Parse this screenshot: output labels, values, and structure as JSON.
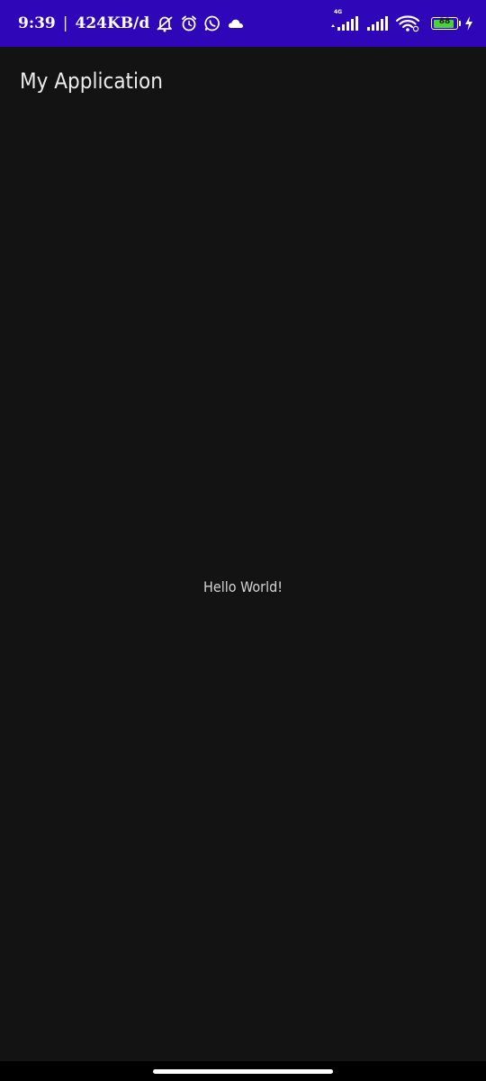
{
  "status_bar": {
    "time": "9:39",
    "separator": "|",
    "net_speed": "424KB/d",
    "network_type": "4G",
    "battery_level": "88",
    "background_color": "#2f06b8",
    "icons_left": [
      "mute-icon",
      "alarm-icon",
      "whatsapp-icon",
      "cloud-icon"
    ],
    "icons_right": [
      "signal-4g-icon",
      "signal-icon",
      "wifi-icon",
      "battery-icon",
      "charging-bolt-icon"
    ]
  },
  "app_bar": {
    "title": "My Application"
  },
  "content": {
    "message": "Hello World!"
  },
  "colors": {
    "background": "#131313",
    "status_bar": "#2f06b8",
    "battery_fill": "#4cd137"
  }
}
